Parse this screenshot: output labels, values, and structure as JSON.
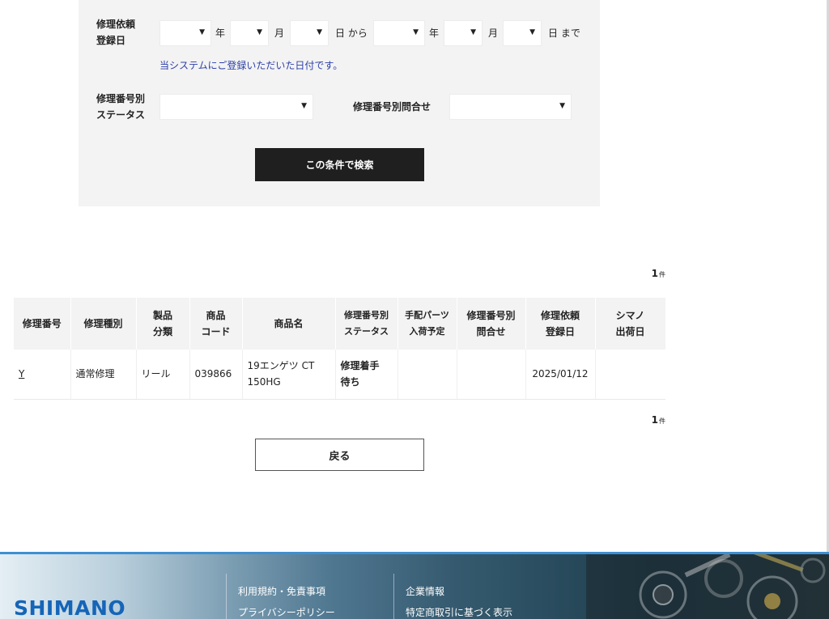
{
  "search": {
    "date_label_1": "修理依頼",
    "date_label_2": "登録日",
    "from": {
      "year": "",
      "month": "",
      "day": ""
    },
    "to": {
      "year": "",
      "month": "",
      "day": ""
    },
    "year_unit": "年",
    "month_unit": "月",
    "from_suffix": "日 から",
    "to_suffix": "日 まで",
    "date_note": "当システムにご登録いただいた日付です。",
    "status_label_1": "修理番号別",
    "status_label_2": "ステータス",
    "status_value": "",
    "inquiry_label": "修理番号別問合せ",
    "inquiry_value": "",
    "search_button": "この条件で検索"
  },
  "results": {
    "count_top": "1",
    "count_unit": "件",
    "count_bottom": "1",
    "headers": [
      [
        "修理番号"
      ],
      [
        "修理種別"
      ],
      [
        "製品",
        "分類"
      ],
      [
        "商品",
        "コード"
      ],
      [
        "商品名"
      ],
      [
        "修理番号別",
        "ステータス"
      ],
      [
        "手配パーツ",
        "入荷予定"
      ],
      [
        "修理番号別",
        "問合せ"
      ],
      [
        "修理依頼",
        "登録日"
      ],
      [
        "シマノ",
        "出荷日"
      ]
    ],
    "rows": [
      {
        "repair_no": "Y",
        "repair_type": "通常修理",
        "category": "リール",
        "product_code": "039866",
        "product_name_1": "19エンゲツ CT",
        "product_name_2": "150HG",
        "status_1": "修理着手",
        "status_2": "待ち",
        "parts_eta": "",
        "inquiry": "",
        "registered": "2025/01/12",
        "shipped": ""
      }
    ],
    "back_button": "戻る"
  },
  "footer": {
    "logo": "SHIMANO",
    "links_col1": [
      "利用規約・免責事項",
      "プライバシーポリシー"
    ],
    "links_col2": [
      "企業情報",
      "特定商取引に基づく表示"
    ]
  },
  "colors": {
    "search_button_bg": "#1f1f1f",
    "note_text": "#2b3fa8",
    "logo_blue": "#1565b8",
    "footer_accent": "#3f8fd2"
  }
}
